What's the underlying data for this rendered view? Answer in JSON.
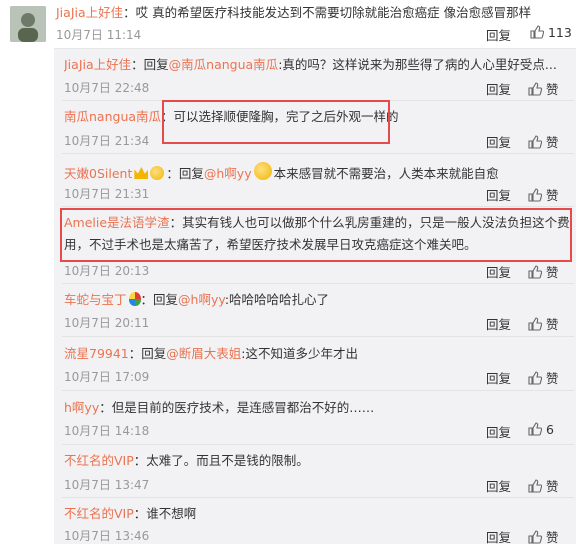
{
  "top": {
    "author": "JiaJia上好佳",
    "text": "：哎 真的希望医疗科技能发达到不需要切除就能治愈癌症 像治愈感冒那样",
    "time": "10月7日 11:14",
    "reply_label": "回复",
    "like_count": "113"
  },
  "replies": [
    {
      "author": "JiaJia上好佳",
      "pre": "：回复",
      "mention": "@南瓜nangua南瓜",
      "text": ":真的吗？这样说来为那些得了病的人心里好受点...",
      "time": "10月7日 22:48",
      "reply": "回复",
      "like": "赞"
    },
    {
      "author": "南瓜nangua南瓜",
      "text": "：可以选择顺便隆胸，完了之后外观一样的",
      "time": "10月7日 21:34",
      "reply": "回复",
      "like": "赞"
    },
    {
      "author": "天嫩0Silent",
      "pre": "：回复",
      "mention": "@h啊yy",
      "text": "本来感冒就不需要治，人类本来就能自愈",
      "time": "10月7日 21:31",
      "reply": "回复",
      "like": "赞"
    },
    {
      "author": "Amelie是法语学渣",
      "text1": "：其实有钱人也可以做那个什么乳房重建的，只是一般人没法负担这个费",
      "text2": "用，不过手术也是太痛苦了，希望医疗技术发展早日攻克癌症这个难关吧。",
      "time": "10月7日 20:13",
      "reply": "回复",
      "like": "赞"
    },
    {
      "author": "车蛇与宝丁",
      "pre": "：回复",
      "mention": "@h啊yy",
      "text": ":哈哈哈哈哈扎心了",
      "time": "10月7日 20:11",
      "reply": "回复",
      "like": "赞"
    },
    {
      "author": "流星79941",
      "pre": "：回复",
      "mention": "@断眉大表姐",
      "text": ":这不知道多少年才出",
      "time": "10月7日 17:09",
      "reply": "回复",
      "like": "赞"
    },
    {
      "author": "h啊yy",
      "text": "：但是目前的医疗技术，是连感冒都治不好的……",
      "time": "10月7日 14:18",
      "reply": "回复",
      "like": "6"
    },
    {
      "author": "不红名的VIP",
      "text": "：太难了。而且不是钱的限制。",
      "time": "10月7日 13:47",
      "reply": "回复",
      "like": "赞"
    },
    {
      "author": "不红名的VIP",
      "text": "：谁不想啊",
      "time": "10月7日 13:46",
      "reply": "回复",
      "like": "赞"
    }
  ]
}
